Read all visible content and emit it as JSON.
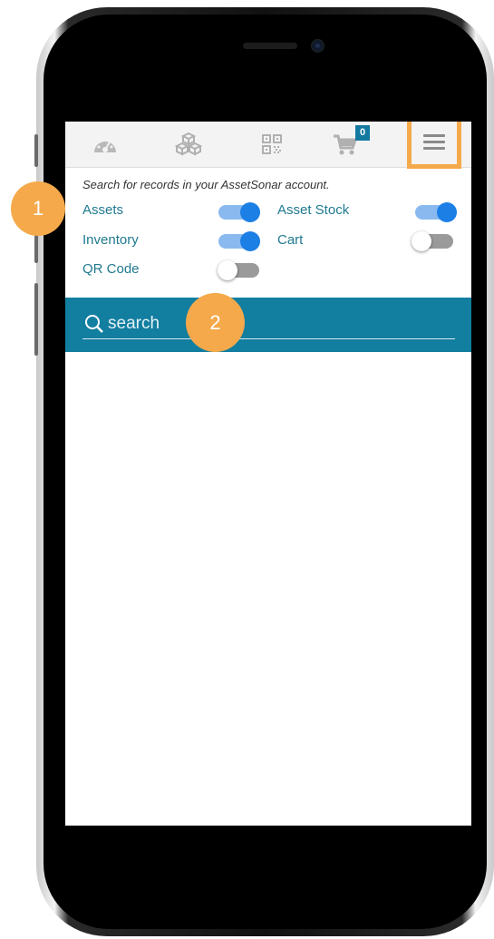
{
  "toolbar": {
    "icons": [
      "dashboard-icon",
      "assets-cubes-icon",
      "qr-code-icon",
      "cart-icon",
      "hamburger-menu-icon"
    ],
    "cart_count": "0"
  },
  "filters": {
    "hint": "Search for records in your AssetSonar account.",
    "items": [
      {
        "label": "Assets",
        "on": true
      },
      {
        "label": "Asset Stock",
        "on": true
      },
      {
        "label": "Inventory",
        "on": true
      },
      {
        "label": "Cart",
        "on": false
      },
      {
        "label": "QR Code",
        "on": false
      }
    ]
  },
  "search": {
    "placeholder": "search",
    "value": ""
  },
  "callouts": {
    "step1": "1",
    "step2": "2"
  },
  "colors": {
    "accent_orange": "#f5a94b",
    "search_bar": "#127ea0",
    "toggle_on": "#1c7fe6",
    "label_teal": "#1f7a8f"
  }
}
